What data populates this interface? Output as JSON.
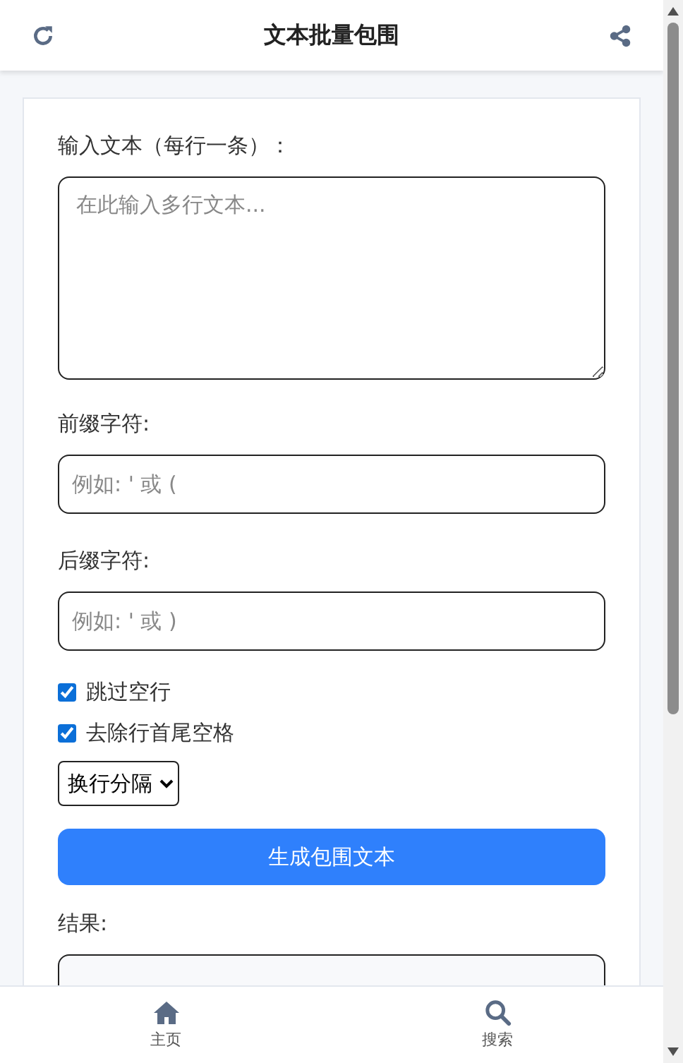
{
  "header": {
    "title": "文本批量包围"
  },
  "form": {
    "input_label": "输入文本（每行一条）：",
    "input_placeholder": "在此输入多行文本...",
    "prefix_label": "前缀字符:",
    "prefix_placeholder": "例如: ' 或 (",
    "suffix_label": "后缀字符:",
    "suffix_placeholder": "例如: ' 或 )",
    "options": [
      {
        "label": "跳过空行",
        "checked": true
      },
      {
        "label": "去除行首尾空格",
        "checked": true
      }
    ],
    "separator": "换行分隔",
    "generate_button": "生成包围文本",
    "result_label": "结果:"
  },
  "bottom_nav": [
    {
      "label": "主页",
      "kind": "home"
    },
    {
      "label": "搜索",
      "kind": "search"
    }
  ]
}
